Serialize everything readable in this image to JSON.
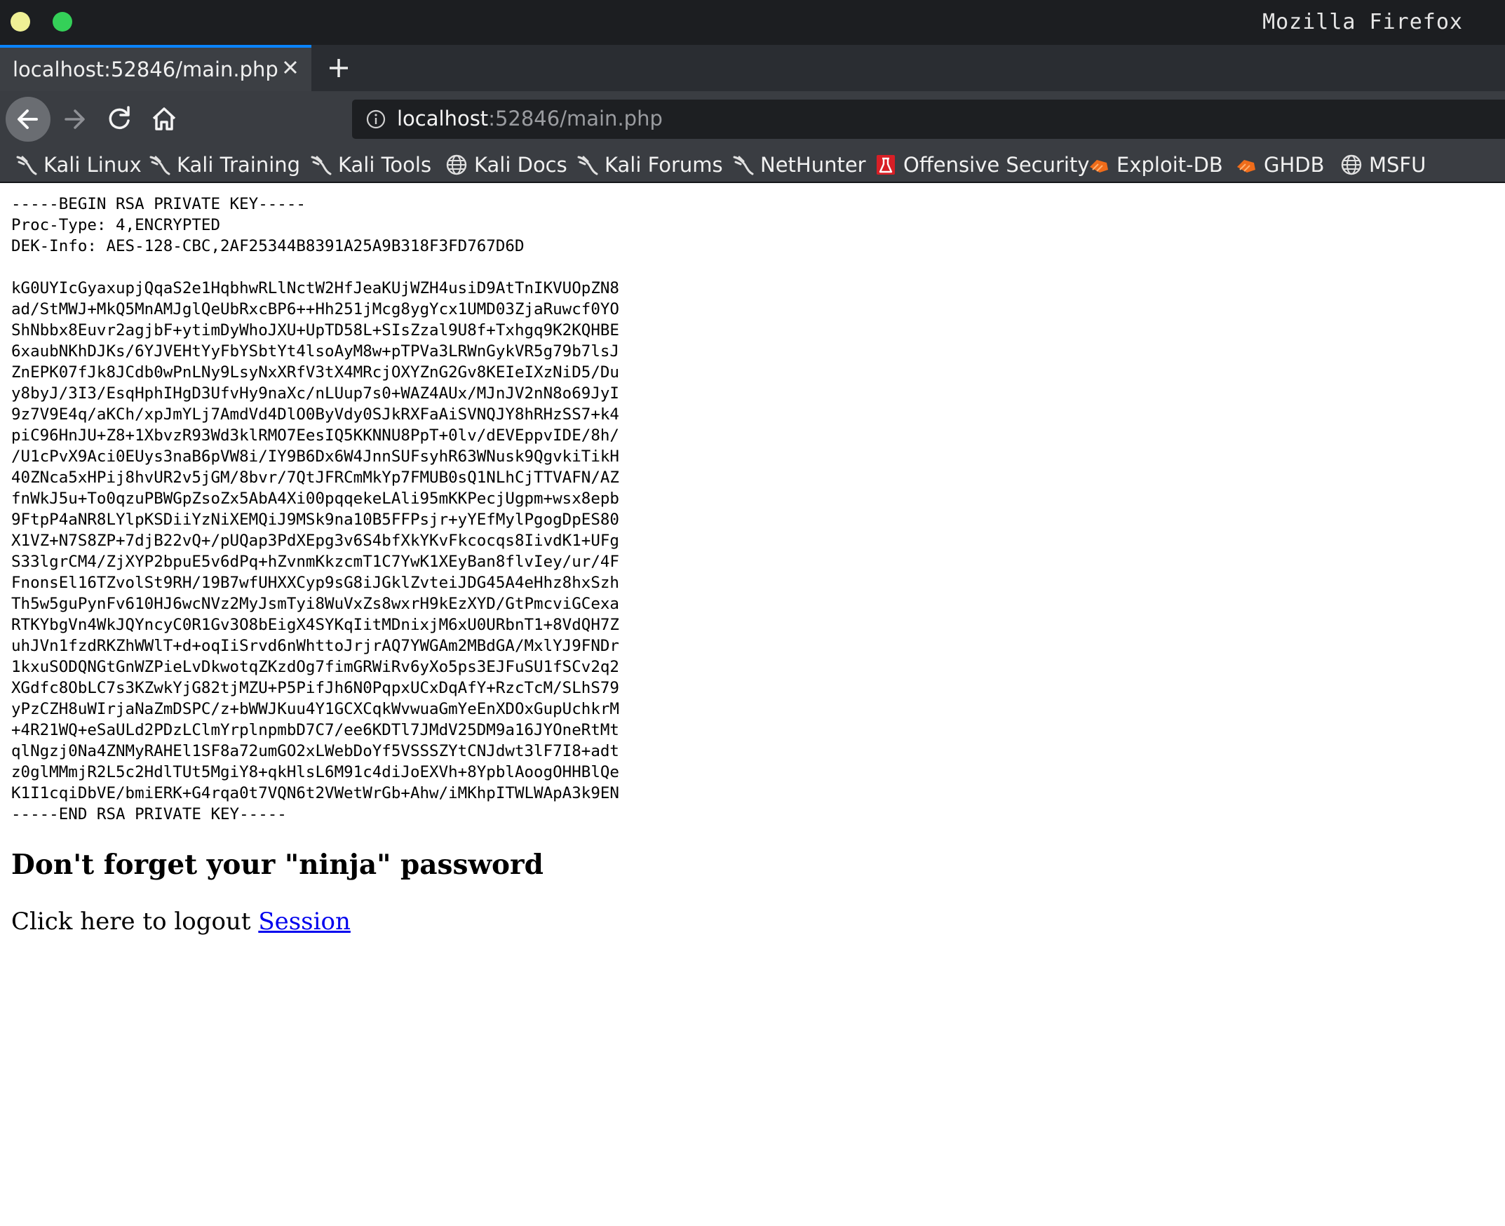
{
  "window": {
    "title": "Mozilla Firefox"
  },
  "tab": {
    "title": "localhost:52846/main.php"
  },
  "url": {
    "host": "localhost",
    "rest": ":52846/main.php"
  },
  "bookmarks": [
    {
      "label": "Kali Linux",
      "icon": "kali-dragon-icon"
    },
    {
      "label": "Kali Training",
      "icon": "kali-dragon-icon"
    },
    {
      "label": "Kali Tools",
      "icon": "kali-dragon-icon"
    },
    {
      "label": "Kali Docs",
      "icon": "globe-icon"
    },
    {
      "label": "Kali Forums",
      "icon": "kali-dragon-icon"
    },
    {
      "label": "NetHunter",
      "icon": "kali-dragon-icon"
    },
    {
      "label": "Offensive Security",
      "icon": "offsec-icon"
    },
    {
      "label": "Exploit-DB",
      "icon": "exploitdb-icon"
    },
    {
      "label": "GHDB",
      "icon": "exploitdb-icon"
    },
    {
      "label": "MSFU",
      "icon": "globe-icon"
    }
  ],
  "page": {
    "key_text": "-----BEGIN RSA PRIVATE KEY-----\nProc-Type: 4,ENCRYPTED\nDEK-Info: AES-128-CBC,2AF25344B8391A25A9B318F3FD767D6D\n\nkG0UYIcGyaxupjQqaS2e1HqbhwRLlNctW2HfJeaKUjWZH4usiD9AtTnIKVUOpZN8\nad/StMWJ+MkQ5MnAMJglQeUbRxcBP6++Hh251jMcg8ygYcx1UMD03ZjaRuwcf0YO\nShNbbx8Euvr2agjbF+ytimDyWhoJXU+UpTD58L+SIsZzal9U8f+Txhgq9K2KQHBE\n6xaubNKhDJKs/6YJVEHtYyFbYSbtYt4lsoAyM8w+pTPVa3LRWnGykVR5g79b7lsJ\nZnEPK07fJk8JCdb0wPnLNy9LsyNxXRfV3tX4MRcjOXYZnG2Gv8KEIeIXzNiD5/Du\ny8byJ/3I3/EsqHphIHgD3UfvHy9naXc/nLUup7s0+WAZ4AUx/MJnJV2nN8o69JyI\n9z7V9E4q/aKCh/xpJmYLj7AmdVd4DlO0ByVdy0SJkRXFaAiSVNQJY8hRHzSS7+k4\npiC96HnJU+Z8+1XbvzR93Wd3klRMO7EesIQ5KKNNU8PpT+0lv/dEVEppvIDE/8h/\n/U1cPvX9Aci0EUys3naB6pVW8i/IY9B6Dx6W4JnnSUFsyhR63WNusk9QgvkiTikH\n40ZNca5xHPij8hvUR2v5jGM/8bvr/7QtJFRCmMkYp7FMUB0sQ1NLhCjTTVAFN/AZ\nfnWkJ5u+To0qzuPBWGpZsoZx5AbA4Xi00pqqekeLAli95mKKPecjUgpm+wsx8epb\n9FtpP4aNR8LYlpKSDiiYzNiXEMQiJ9MSk9na10B5FFPsjr+yYEfMylPgogDpES80\nX1VZ+N7S8ZP+7djB22vQ+/pUQap3PdXEpg3v6S4bfXkYKvFkcocqs8IivdK1+UFg\nS33lgrCM4/ZjXYP2bpuE5v6dPq+hZvnmKkzcmT1C7YwK1XEyBan8flvIey/ur/4F\nFnonsEl16TZvolSt9RH/19B7wfUHXXCyp9sG8iJGklZvteiJDG45A4eHhz8hxSzh\nTh5w5guPynFv610HJ6wcNVz2MyJsmTyi8WuVxZs8wxrH9kEzXYD/GtPmcviGCexa\nRTKYbgVn4WkJQYncyC0R1Gv3O8bEigX4SYKqIitMDnixjM6xU0URbnT1+8VdQH7Z\nuhJVn1fzdRKZhWWlT+d+oqIiSrvd6nWhttoJrjrAQ7YWGAm2MBdGA/MxlYJ9FNDr\n1kxuSODQNGtGnWZPieLvDkwotqZKzdOg7fimGRWiRv6yXo5ps3EJFuSU1fSCv2q2\nXGdfc8ObLC7s3KZwkYjG82tjMZU+P5PifJh6N0PqpxUCxDqAfY+RzcTcM/SLhS79\nyPzCZH8uWIrjaNaZmDSPC/z+bWWJKuu4Y1GCXCqkWvwuaGmYeEnXDOxGupUchkrM\n+4R21WQ+eSaULd2PDzLClmYrplnpmbD7C7/ee6KDTl7JMdV25DM9a16JYOneRtMt\nqlNgzj0Na4ZNMyRAHEl1SF8a72umGO2xLWebDoYf5VSSSZYtCNJdwt3lF7I8+adt\nz0glMMmjR2L5c2HdlTUt5MgiY8+qkHlsL6M91c4diJoEXVh+8YpblAoogOHHBlQe\nK1I1cqiDbVE/bmiERK+G4rqa0t7VQN6t2VWetWrGb+Ahw/iMKhpITWLWApA3k9EN\n-----END RSA PRIVATE KEY-----",
    "notice": "Don't forget your \"ninja\" password",
    "logout_text": "Click here to logout ",
    "logout_link": "Session"
  }
}
